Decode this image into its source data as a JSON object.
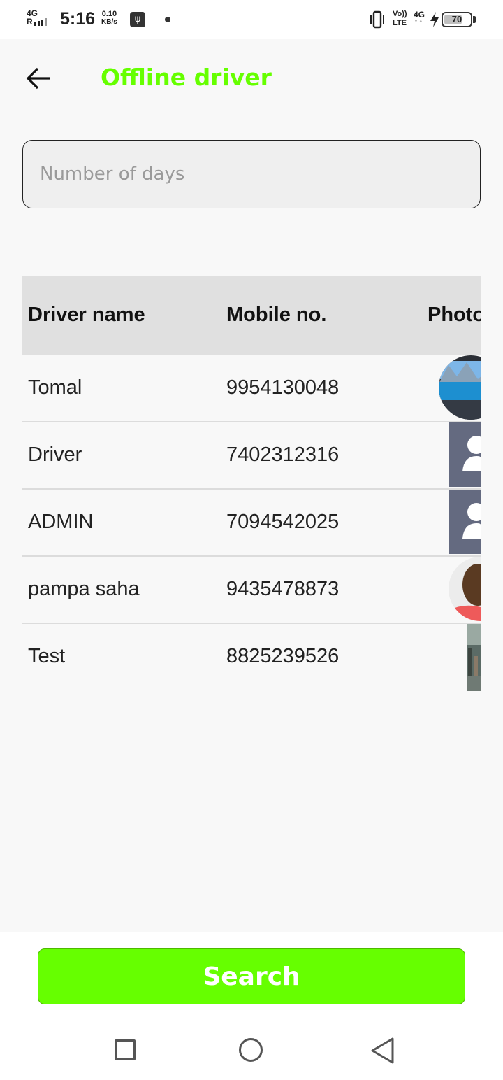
{
  "status_bar": {
    "network_top": "4G",
    "network_bottom": "R",
    "time": "5:16",
    "speed_value": "0.10",
    "speed_unit": "KB/s",
    "volte_top": "Vo))",
    "volte_bottom": "LTE",
    "data_type": "4G",
    "battery_level": "70",
    "battery_fraction": 0.7
  },
  "header": {
    "title": "Offline driver",
    "title_color": "#66ff00"
  },
  "filter": {
    "days_placeholder": "Number of days",
    "days_value": ""
  },
  "table": {
    "columns": [
      "Driver name",
      "Mobile no.",
      "Photo"
    ],
    "rows": [
      {
        "name": "Tomal",
        "mobile": "9954130048",
        "photo": "landscape-photo"
      },
      {
        "name": "Driver",
        "mobile": "7402312316",
        "photo": "default-avatar"
      },
      {
        "name": "ADMIN",
        "mobile": "7094542025",
        "photo": "default-avatar"
      },
      {
        "name": "pampa saha",
        "mobile": "9435478873",
        "photo": "person-photo"
      },
      {
        "name": "Test",
        "mobile": "8825239526",
        "photo": "street-photo"
      }
    ]
  },
  "actions": {
    "search_label": "Search",
    "search_color": "#66ff00"
  }
}
